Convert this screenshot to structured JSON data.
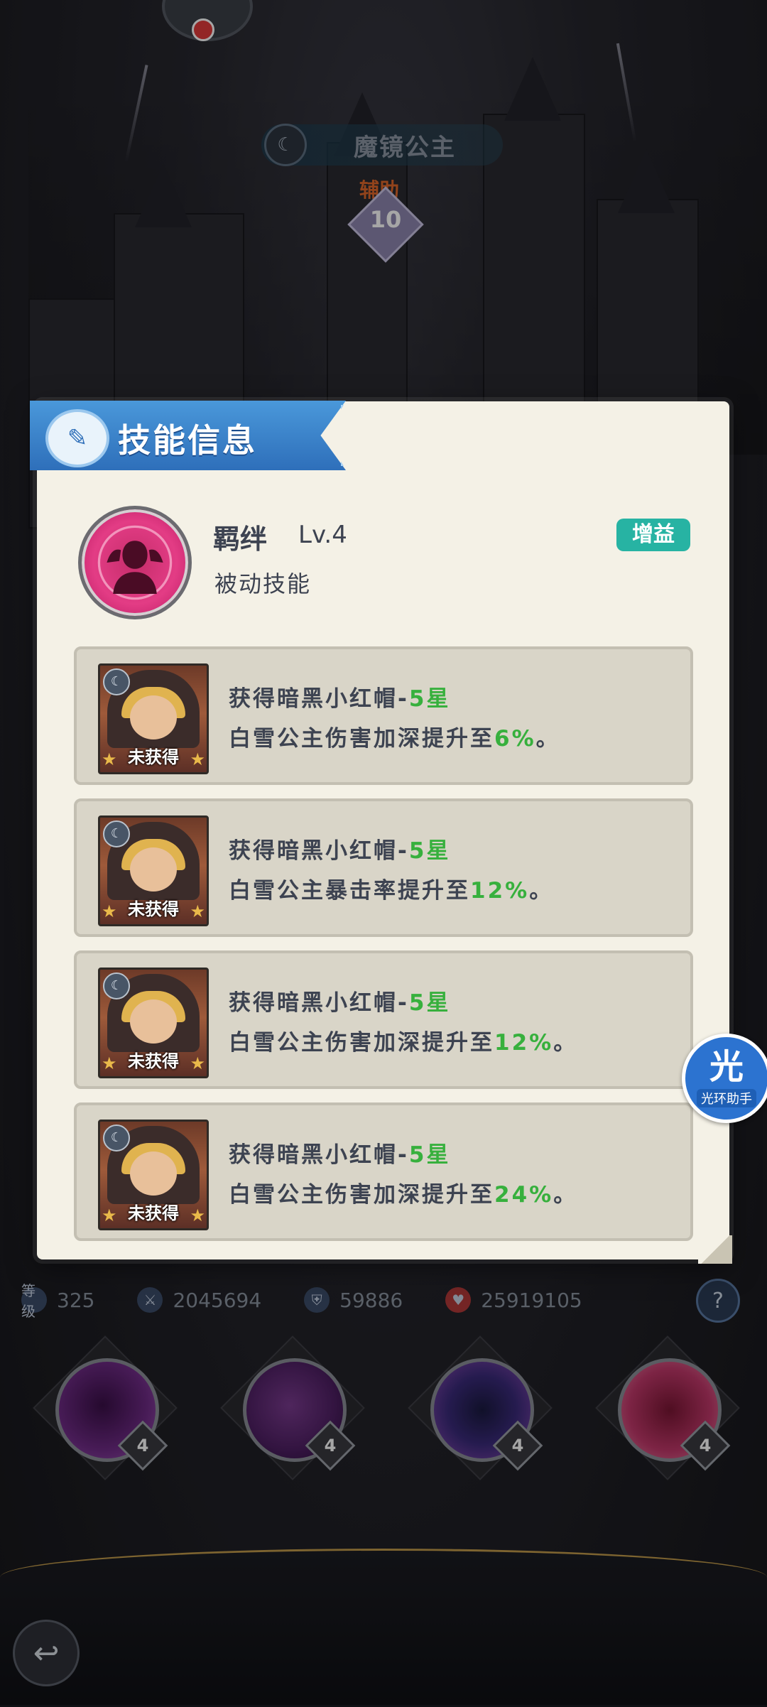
{
  "scene": {
    "hero_name": "魔镜公主",
    "role": "辅助",
    "level": "10"
  },
  "stats": {
    "level_label": "等级",
    "level_value": "325",
    "attack": "2045694",
    "defense": "59886",
    "hp": "25919105"
  },
  "skills_bar": [
    {
      "name": "apple",
      "level": "4"
    },
    {
      "name": "vortex",
      "level": "4"
    },
    {
      "name": "galaxy",
      "level": "4"
    },
    {
      "name": "bond",
      "level": "4"
    }
  ],
  "modal": {
    "title": "技能信息",
    "skill_name": "羁绊",
    "skill_level": "Lv.4",
    "skill_type": "被动技能",
    "badge": "增益",
    "badge_color": "#27b3a3",
    "conditions": [
      {
        "status": "未获得",
        "req_text": "获得暗黑小红帽-",
        "req_stars": "5星",
        "effect_text": "白雪公主伤害加深提升至",
        "effect_value": "6%",
        "end": "。"
      },
      {
        "status": "未获得",
        "req_text": "获得暗黑小红帽-",
        "req_stars": "5星",
        "effect_text": "白雪公主暴击率提升至",
        "effect_value": "12%",
        "end": "。"
      },
      {
        "status": "未获得",
        "req_text": "获得暗黑小红帽-",
        "req_stars": "5星",
        "effect_text": "白雪公主伤害加深提升至",
        "effect_value": "12%",
        "end": "。"
      },
      {
        "status": "未获得",
        "req_text": "获得暗黑小红帽-",
        "req_stars": "5星",
        "effect_text": "白雪公主伤害加深提升至",
        "effect_value": "24%",
        "end": "。"
      }
    ]
  },
  "helper": {
    "big": "光",
    "small": "光环助手"
  },
  "colors": {
    "accent_green": "#37b03d",
    "header_blue": "#3a84cf"
  }
}
